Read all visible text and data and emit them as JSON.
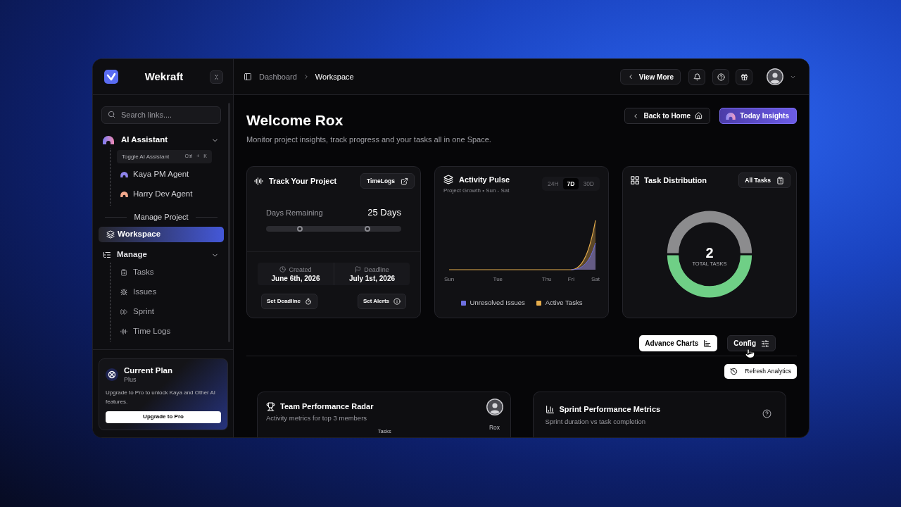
{
  "sidebar": {
    "brand": "Wekraft",
    "search": {
      "placeholder": "Search links...."
    },
    "ai_assistant": {
      "label": "AI Assistant",
      "expanded": true,
      "shortcut": {
        "label": "Toggle AI Assistant",
        "keys": "Ctrl + K"
      },
      "children": [
        {
          "label": "Kaya PM Agent",
          "color": "#8e84ec"
        },
        {
          "label": "Harry Dev Agent",
          "color": "#f2a88c"
        }
      ]
    },
    "section_label": "Manage Project",
    "nav": [
      {
        "kind": "link",
        "label": "Workspace",
        "selected": true
      },
      {
        "kind": "group",
        "label": "Manage",
        "selected": false,
        "expanded": true,
        "children": [
          {
            "label": "Tasks",
            "selected": false
          },
          {
            "label": "Issues",
            "selected": false
          },
          {
            "label": "Sprint",
            "selected": false
          },
          {
            "label": "Time Logs",
            "selected": false
          }
        ]
      }
    ],
    "plan": {
      "title": "Current Plan",
      "tier": "Plus",
      "text": "Upgrade to Pro to unlock Kaya and Other AI features.",
      "button": "Upgrade to Pro"
    }
  },
  "topbar": {
    "breadcrumbs": [
      {
        "label": "Dashboard",
        "selected": false
      },
      {
        "label": "Workspace",
        "selected": true
      }
    ],
    "view_more": "View More"
  },
  "header": {
    "title": "Welcome Rox",
    "subtitle": "Monitor project insights, track progress and your tasks all in one Space.",
    "actions": [
      {
        "kind": "outline",
        "label": "Back to Home"
      },
      {
        "kind": "accent",
        "label": "Today Insights"
      }
    ]
  },
  "track_card": {
    "title": "Track Your Project",
    "button": "TimeLogs",
    "remaining_label": "Days Remaining",
    "remaining_value": "25 Days",
    "thumbs": [
      {
        "level": 0.25
      },
      {
        "level": 0.75
      }
    ],
    "dates": [
      {
        "label": "Created",
        "value": "June 6th, 2026"
      },
      {
        "label": "Deadline",
        "value": "July 1st, 2026"
      }
    ],
    "actions": [
      "Set Deadline",
      "Set Alerts"
    ]
  },
  "activity_card": {
    "title": "Activity Pulse",
    "subtitle": "Project Growth • Sun - Sat",
    "ranges": [
      {
        "label": "24H",
        "selected": false
      },
      {
        "label": "7D",
        "selected": true
      },
      {
        "label": "30D",
        "selected": false
      }
    ],
    "x_labels": [
      "Sun",
      "Tue",
      "Thu",
      "Fri",
      "Sat"
    ],
    "legend": [
      {
        "label": "Unresolved Issues",
        "color": "#6d6fe0"
      },
      {
        "label": "Active Tasks",
        "color": "#e6ad4c"
      }
    ]
  },
  "distribution_card": {
    "title": "Task Distribution",
    "button": "All Tasks",
    "total": "2",
    "total_label": "TOTAL TASKS"
  },
  "toolbar": {
    "buttons": [
      {
        "kind": "light",
        "label": "Advance Charts"
      },
      {
        "kind": "dark",
        "label": "Config"
      }
    ],
    "refresh": "Refresh Analytics"
  },
  "radar_card": {
    "title": "Team Performance Radar",
    "subtitle": "Activity metrics for top 3 members",
    "member": "Rox",
    "axis_label": "Tasks"
  },
  "sprint_card": {
    "title": "Sprint Performance Metrics",
    "subtitle": "Sprint duration vs task completion"
  }
}
